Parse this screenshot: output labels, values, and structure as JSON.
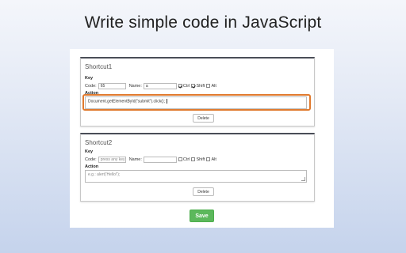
{
  "headline": "Write simple code in JavaScript",
  "shortcuts": [
    {
      "title": "Shortcut1",
      "key_label": "Key",
      "code_label": "Code:",
      "code_value": "65",
      "name_label": "Name:",
      "name_value": "a",
      "ctrl_label": "Ctrl",
      "ctrl_checked": true,
      "shift_label": "Shift",
      "shift_checked": true,
      "alt_label": "Alt",
      "alt_checked": false,
      "action_label": "Action",
      "action_value": "Document.getElementById(\"submit\").click();",
      "delete_label": "Delete"
    },
    {
      "title": "Shortcut2",
      "key_label": "Key",
      "code_label": "Code:",
      "code_placeholder": "press any key",
      "name_label": "Name:",
      "name_value": "",
      "ctrl_label": "Ctrl",
      "ctrl_checked": false,
      "shift_label": "Shift",
      "shift_checked": false,
      "alt_label": "Alt",
      "alt_checked": false,
      "action_label": "Action",
      "action_placeholder": "e.g.: alert('Hello!');",
      "delete_label": "Delete"
    }
  ],
  "save_label": "Save",
  "colors": {
    "highlight": "#e07a2e",
    "save": "#5cb85c",
    "card_top_border": "#4a4d57"
  }
}
